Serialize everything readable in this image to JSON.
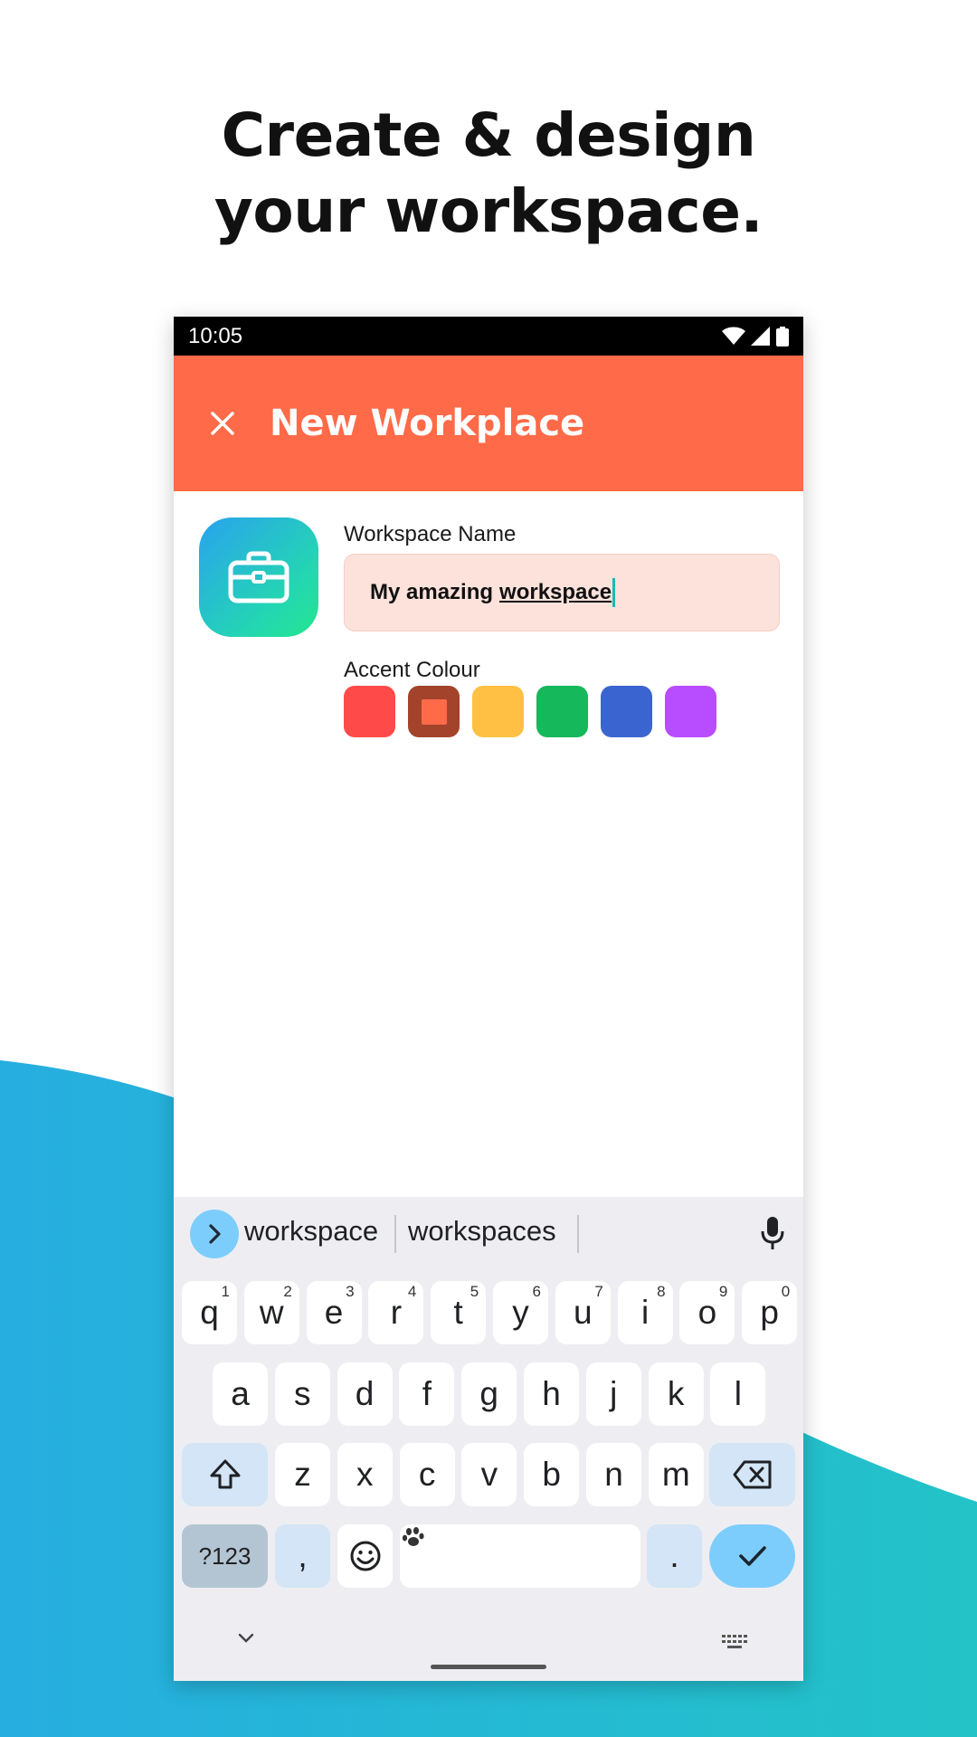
{
  "headline": {
    "line1": "Create & design",
    "line2": "your workspace."
  },
  "status_bar": {
    "time": "10:05"
  },
  "app_bar": {
    "title": "New Workplace"
  },
  "form": {
    "name_label": "Workspace Name",
    "name_value_word1": "My amazing",
    "name_value_word2": "workspace",
    "accent_label": "Accent Colour",
    "accent_colors": [
      "#ff4a4a",
      "#a3432c",
      "#ffc043",
      "#15b85b",
      "#3a64d0",
      "#b84dff"
    ],
    "selected_accent": "#ff6a48"
  },
  "keyboard": {
    "suggestions": [
      "workspace",
      "workspaces"
    ],
    "row1": [
      {
        "k": "q",
        "h": "1"
      },
      {
        "k": "w",
        "h": "2"
      },
      {
        "k": "e",
        "h": "3"
      },
      {
        "k": "r",
        "h": "4"
      },
      {
        "k": "t",
        "h": "5"
      },
      {
        "k": "y",
        "h": "6"
      },
      {
        "k": "u",
        "h": "7"
      },
      {
        "k": "i",
        "h": "8"
      },
      {
        "k": "o",
        "h": "9"
      },
      {
        "k": "p",
        "h": "0"
      }
    ],
    "row2": [
      "a",
      "s",
      "d",
      "f",
      "g",
      "h",
      "j",
      "k",
      "l"
    ],
    "row3": [
      "z",
      "x",
      "c",
      "v",
      "b",
      "n",
      "m"
    ],
    "sym_label": "?123",
    "comma": ",",
    "period": "."
  },
  "colors": {
    "app_bar": "#ff6a48",
    "wave_left": "#26aee0",
    "wave_right": "#23c3c8"
  }
}
